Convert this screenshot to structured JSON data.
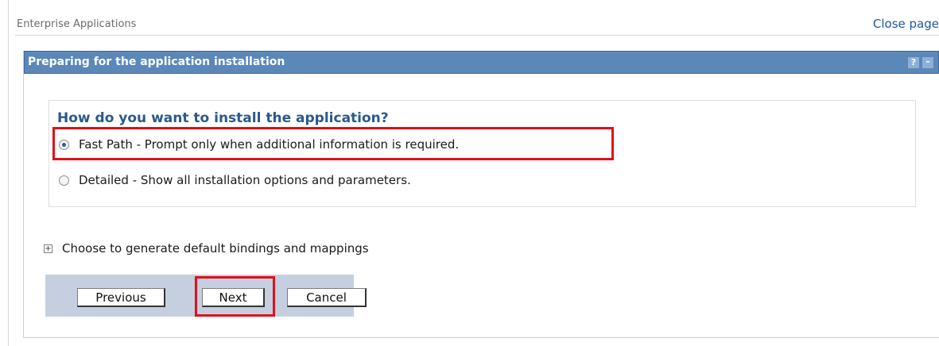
{
  "header": {
    "breadcrumb": "Enterprise Applications",
    "close_label": "Close page"
  },
  "portlet": {
    "title": "Preparing for the application installation",
    "help_label": "?",
    "minimize_label": "–"
  },
  "question": {
    "title": "How do you want to install the application?",
    "options": [
      {
        "label": "Fast Path - Prompt only when additional information is required.",
        "selected": true
      },
      {
        "label": "Detailed - Show all installation options and parameters.",
        "selected": false
      }
    ]
  },
  "expand": {
    "icon": "+",
    "label": "Choose to generate default bindings and mappings"
  },
  "buttons": {
    "previous": "Previous",
    "next": "Next",
    "cancel": "Cancel"
  },
  "colors": {
    "titlebar": "#5b87b9",
    "highlight": "#e0101a",
    "button_bar": "#c5cfe0",
    "link": "#1f56a8"
  }
}
